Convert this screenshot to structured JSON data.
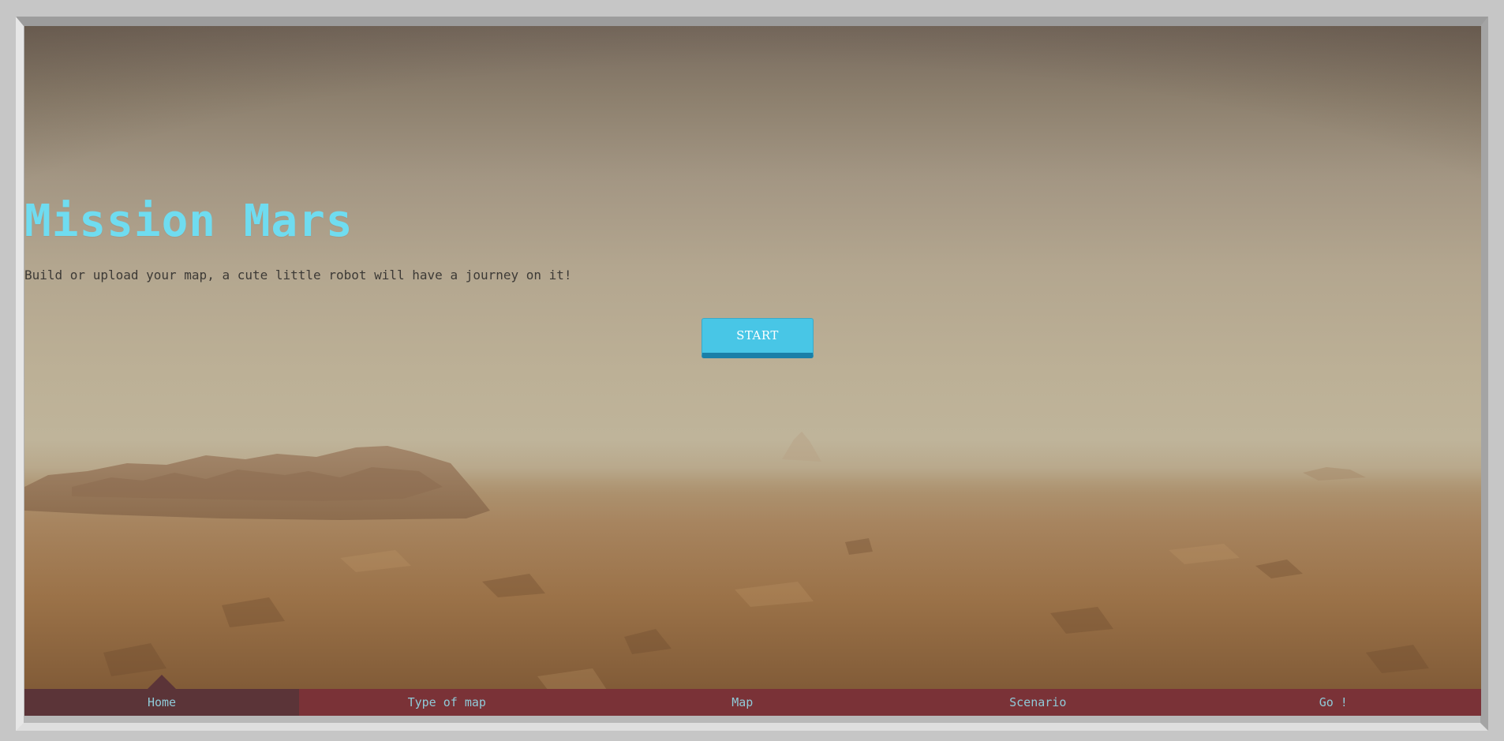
{
  "hero": {
    "title": "Mission Mars",
    "subtitle": "Build or upload your map, a cute little robot will have a journey on it!",
    "start_label": "START"
  },
  "nav": {
    "items": [
      {
        "label": "Home",
        "active": true
      },
      {
        "label": "Type of map",
        "active": false
      },
      {
        "label": "Map",
        "active": false
      },
      {
        "label": "Scenario",
        "active": false
      },
      {
        "label": "Go !",
        "active": false
      }
    ]
  },
  "colors": {
    "title": "#6fdcf0",
    "button": "#48c6e6",
    "button_shadow": "#1a7fa8",
    "nav_bg": "#7a3237",
    "nav_active_bg": "#5b3438",
    "nav_text": "#8fcad8"
  }
}
